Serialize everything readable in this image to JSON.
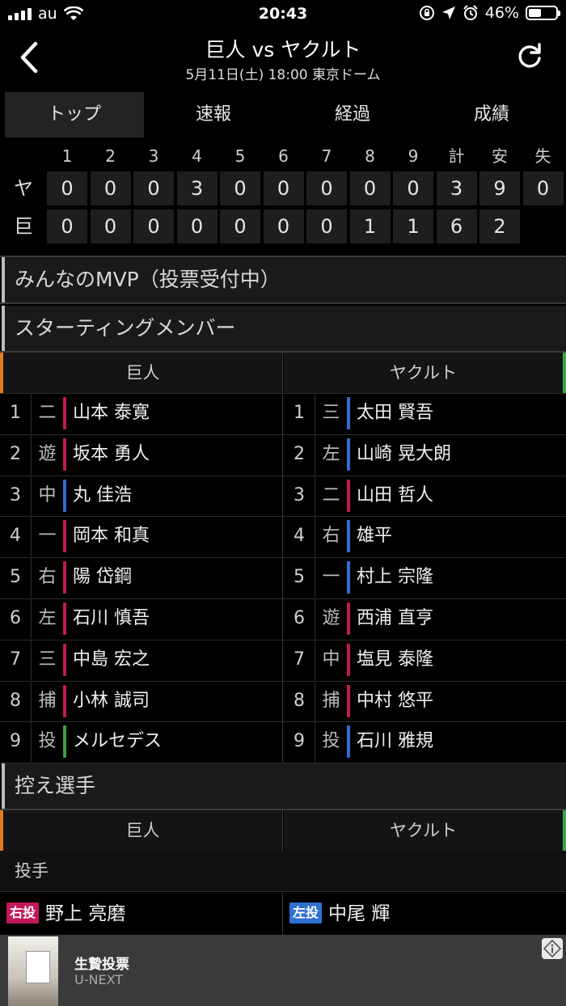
{
  "status": {
    "carrier": "au",
    "time": "20:43",
    "battery": "46%",
    "battery_level": 0.46
  },
  "header": {
    "title": "巨人 vs ヤクルト",
    "subtitle": "5月11日(土) 18:00 東京ドーム"
  },
  "tabs": [
    {
      "label": "トップ",
      "active": true
    },
    {
      "label": "速報"
    },
    {
      "label": "経過"
    },
    {
      "label": "成績"
    }
  ],
  "scoreboard": {
    "headers": [
      "1",
      "2",
      "3",
      "4",
      "5",
      "6",
      "7",
      "8",
      "9",
      "計",
      "安",
      "失"
    ],
    "rows": [
      {
        "team": "ヤ",
        "values": [
          "0",
          "0",
          "0",
          "3",
          "0",
          "0",
          "0",
          "0",
          "0",
          "3",
          "9",
          "0"
        ]
      },
      {
        "team": "巨",
        "values": [
          "0",
          "0",
          "0",
          "0",
          "0",
          "0",
          "0",
          "1",
          "1",
          "6",
          "2"
        ]
      }
    ]
  },
  "sections": {
    "mvp": "みんなのMVP（投票受付中）",
    "starting": "スターティングメンバー",
    "bench": "控え選手"
  },
  "teams": {
    "home": "巨人",
    "away": "ヤクルト"
  },
  "lineup": {
    "home": [
      {
        "num": "1",
        "pos": "二",
        "name": "山本 泰寛",
        "color": "#c2185b"
      },
      {
        "num": "2",
        "pos": "遊",
        "name": "坂本 勇人",
        "color": "#c2185b"
      },
      {
        "num": "3",
        "pos": "中",
        "name": "丸 佳浩",
        "color": "#2f6fd1"
      },
      {
        "num": "4",
        "pos": "一",
        "name": "岡本 和真",
        "color": "#c2185b"
      },
      {
        "num": "5",
        "pos": "右",
        "name": "陽 岱鋼",
        "color": "#c2185b"
      },
      {
        "num": "6",
        "pos": "左",
        "name": "石川 慎吾",
        "color": "#c2185b"
      },
      {
        "num": "7",
        "pos": "三",
        "name": "中島 宏之",
        "color": "#c2185b"
      },
      {
        "num": "8",
        "pos": "捕",
        "name": "小林 誠司",
        "color": "#c2185b"
      },
      {
        "num": "9",
        "pos": "投",
        "name": "メルセデス",
        "color": "#3fa34a"
      }
    ],
    "away": [
      {
        "num": "1",
        "pos": "三",
        "name": "太田 賢吾",
        "color": "#2f6fd1"
      },
      {
        "num": "2",
        "pos": "左",
        "name": "山崎 晃大朗",
        "color": "#2f6fd1"
      },
      {
        "num": "3",
        "pos": "二",
        "name": "山田 哲人",
        "color": "#c2185b"
      },
      {
        "num": "4",
        "pos": "右",
        "name": "雄平",
        "color": "#2f6fd1"
      },
      {
        "num": "5",
        "pos": "一",
        "name": "村上 宗隆",
        "color": "#2f6fd1"
      },
      {
        "num": "6",
        "pos": "遊",
        "name": "西浦 直亨",
        "color": "#c2185b"
      },
      {
        "num": "7",
        "pos": "中",
        "name": "塩見 泰隆",
        "color": "#c2185b"
      },
      {
        "num": "8",
        "pos": "捕",
        "name": "中村 悠平",
        "color": "#c2185b"
      },
      {
        "num": "9",
        "pos": "投",
        "name": "石川 雅規",
        "color": "#2f6fd1"
      }
    ]
  },
  "bench": {
    "pitcher_label": "投手",
    "home": {
      "badge": "右投",
      "badge_color": "#c2185b",
      "name": "野上 亮磨"
    },
    "away": {
      "badge": "左投",
      "badge_color": "#2f6fd1",
      "name": "中尾 輝"
    }
  },
  "ad": {
    "title": "生贄投票",
    "source": "U-NEXT"
  }
}
